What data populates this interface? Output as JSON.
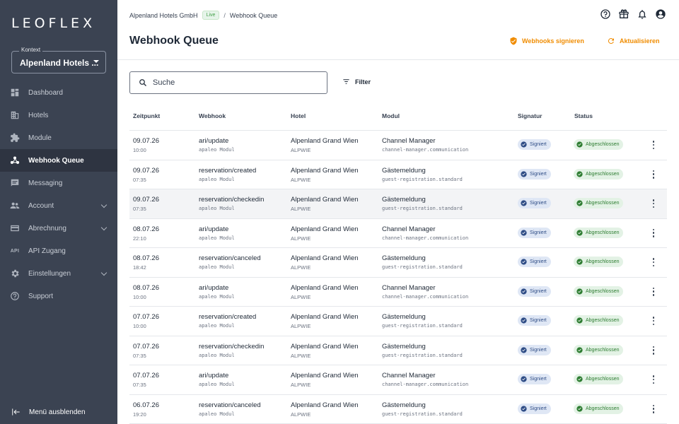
{
  "sidebar": {
    "logo": "LEOFLEX",
    "context_label": "Kontext",
    "context_value": "Alpenland Hotels ...",
    "items": [
      {
        "label": "Dashboard"
      },
      {
        "label": "Hotels"
      },
      {
        "label": "Module"
      },
      {
        "label": "Webhook Queue"
      },
      {
        "label": "Messaging"
      },
      {
        "label": "Account"
      },
      {
        "label": "Abrechnung"
      },
      {
        "label": "API Zugang",
        "icon_text": "API"
      },
      {
        "label": "Einstellungen"
      },
      {
        "label": "Support"
      }
    ],
    "collapse_label": "Menü ausblenden"
  },
  "header": {
    "breadcrumb_org": "Alpenland Hotels GmbH",
    "live_badge": "Live",
    "breadcrumb_sep": "/",
    "breadcrumb_page": "Webhook Queue",
    "title": "Webhook Queue",
    "sign_action": "Webhooks signieren",
    "refresh_action": "Aktualisieren"
  },
  "search": {
    "placeholder": "Suche"
  },
  "filter_label": "Filter",
  "table": {
    "headers": {
      "time": "Zeitpunkt",
      "webhook": "Webhook",
      "hotel": "Hotel",
      "module": "Modul",
      "signature": "Signatur",
      "status": "Status"
    },
    "rows": [
      {
        "date": "09.07.26",
        "time": "10:00",
        "webhook": "ari/update",
        "source": "apaleo Modul",
        "hotel": "Alpenland Grand Wien",
        "code": "ALPWIE",
        "module": "Channel Manager",
        "module_id": "channel-manager.communication",
        "signature": "Signiert",
        "status": "Abgeschlossen"
      },
      {
        "date": "09.07.26",
        "time": "07:35",
        "webhook": "reservation/created",
        "source": "apaleo Modul",
        "hotel": "Alpenland Grand Wien",
        "code": "ALPWIE",
        "module": "Gästemeldung",
        "module_id": "guest-registration.standard",
        "signature": "Signiert",
        "status": "Abgeschlossen"
      },
      {
        "date": "09.07.26",
        "time": "07:35",
        "webhook": "reservation/checkedin",
        "source": "apaleo Modul",
        "hotel": "Alpenland Grand Wien",
        "code": "ALPWIE",
        "module": "Gästemeldung",
        "module_id": "guest-registration.standard",
        "signature": "Signiert",
        "status": "Abgeschlossen"
      },
      {
        "date": "08.07.26",
        "time": "22:10",
        "webhook": "ari/update",
        "source": "apaleo Modul",
        "hotel": "Alpenland Grand Wien",
        "code": "ALPWIE",
        "module": "Channel Manager",
        "module_id": "channel-manager.communication",
        "signature": "Signiert",
        "status": "Abgeschlossen"
      },
      {
        "date": "08.07.26",
        "time": "18:42",
        "webhook": "reservation/canceled",
        "source": "apaleo Modul",
        "hotel": "Alpenland Grand Wien",
        "code": "ALPWIE",
        "module": "Gästemeldung",
        "module_id": "guest-registration.standard",
        "signature": "Signiert",
        "status": "Abgeschlossen"
      },
      {
        "date": "08.07.26",
        "time": "10:00",
        "webhook": "ari/update",
        "source": "apaleo Modul",
        "hotel": "Alpenland Grand Wien",
        "code": "ALPWIE",
        "module": "Channel Manager",
        "module_id": "channel-manager.communication",
        "signature": "Signiert",
        "status": "Abgeschlossen"
      },
      {
        "date": "07.07.26",
        "time": "10:00",
        "webhook": "reservation/created",
        "source": "apaleo Modul",
        "hotel": "Alpenland Grand Wien",
        "code": "ALPWIE",
        "module": "Gästemeldung",
        "module_id": "guest-registration.standard",
        "signature": "Signiert",
        "status": "Abgeschlossen"
      },
      {
        "date": "07.07.26",
        "time": "07:35",
        "webhook": "reservation/checkedin",
        "source": "apaleo Modul",
        "hotel": "Alpenland Grand Wien",
        "code": "ALPWIE",
        "module": "Gästemeldung",
        "module_id": "guest-registration.standard",
        "signature": "Signiert",
        "status": "Abgeschlossen"
      },
      {
        "date": "07.07.26",
        "time": "07:35",
        "webhook": "ari/update",
        "source": "apaleo Modul",
        "hotel": "Alpenland Grand Wien",
        "code": "ALPWIE",
        "module": "Channel Manager",
        "module_id": "channel-manager.communication",
        "signature": "Signiert",
        "status": "Abgeschlossen"
      },
      {
        "date": "06.07.26",
        "time": "19:20",
        "webhook": "reservation/canceled",
        "source": "apaleo Modul",
        "hotel": "Alpenland Grand Wien",
        "code": "ALPWIE",
        "module": "Gästemeldung",
        "module_id": "guest-registration.standard",
        "signature": "Signiert",
        "status": "Abgeschlossen"
      }
    ]
  },
  "colors": {
    "sidebar_bg": "#3b4352",
    "accent": "#f08c00",
    "signed_chip_bg": "#dfe7f5",
    "status_chip_bg": "#e3f2e5"
  },
  "icons": {
    "nav": [
      "dashboard-icon",
      "hotel-icon",
      "puzzle-icon",
      "webhook-icon",
      "message-icon",
      "people-icon",
      "billing-icon",
      "api-icon",
      "gear-icon",
      "help-icon"
    ],
    "top": [
      "help-icon",
      "gift-icon",
      "bell-icon",
      "account-icon"
    ]
  }
}
